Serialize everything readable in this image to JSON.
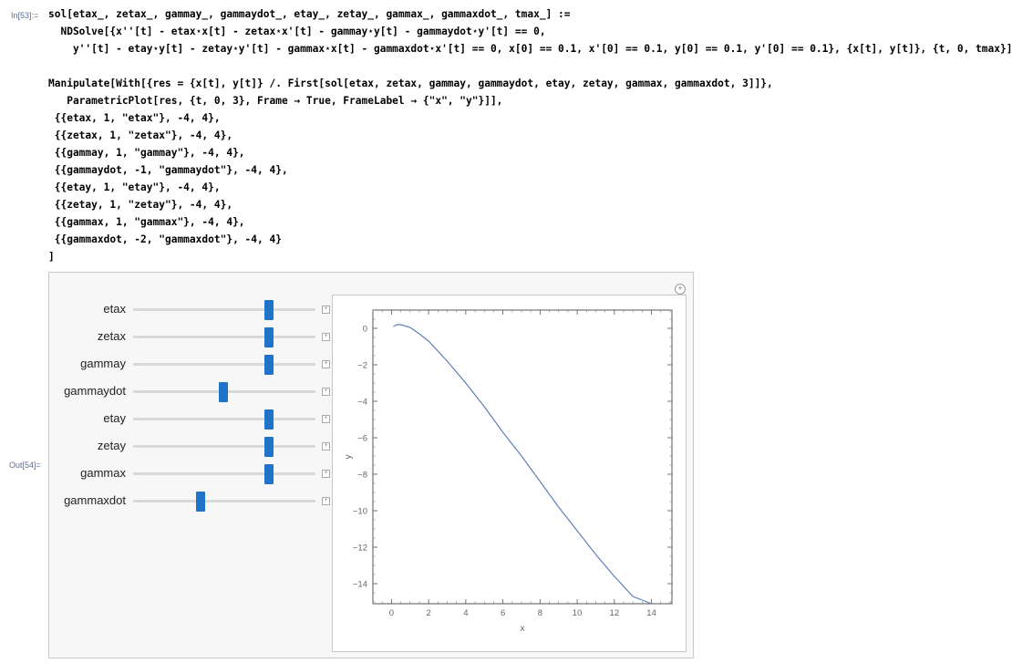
{
  "cells": {
    "in_label": "In[53]:=",
    "out_label": "Out[54]="
  },
  "code_lines": [
    "sol[etax_, zetax_, gammay_, gammaydot_, etay_, zetay_, gammax_, gammaxdot_, tmax_] :=",
    "  NDSolve[{x''[t] - etax⋆x[t] - zetax⋆x'[t] - gammay⋆y[t] - gammaydot⋆y'[t] == 0,",
    "    y''[t] - etay⋆y[t] - zetay⋆y'[t] - gammax⋆x[t] - gammaxdot⋆x'[t] == 0, x[0] == 0.1, x'[0] == 0.1, y[0] == 0.1, y'[0] == 0.1}, {x[t], y[t]}, {t, 0, tmax}]",
    "",
    "Manipulate[With[{res = {x[t], y[t]} /. First[sol[etax, zetax, gammay, gammaydot, etay, zetay, gammax, gammaxdot, 3]]},",
    "   ParametricPlot[res, {t, 0, 3}, Frame → True, FrameLabel → {\"x\", \"y\"}]],",
    " {{etax, 1, \"etax\"}, -4, 4},",
    " {{zetax, 1, \"zetax\"}, -4, 4},",
    " {{gammay, 1, \"gammay\"}, -4, 4},",
    " {{gammaydot, -1, \"gammaydot\"}, -4, 4},",
    " {{etay, 1, \"etay\"}, -4, 4},",
    " {{zetay, 1, \"zetay\"}, -4, 4},",
    " {{gammax, 1, \"gammax\"}, -4, 4},",
    " {{gammaxdot, -2, \"gammaxdot\"}, -4, 4}",
    "]"
  ],
  "controls": [
    {
      "label": "etax",
      "value": 1,
      "min": -4,
      "max": 4
    },
    {
      "label": "zetax",
      "value": 1,
      "min": -4,
      "max": 4
    },
    {
      "label": "gammay",
      "value": 1,
      "min": -4,
      "max": 4
    },
    {
      "label": "gammaydot",
      "value": -1,
      "min": -4,
      "max": 4
    },
    {
      "label": "etay",
      "value": 1,
      "min": -4,
      "max": 4
    },
    {
      "label": "zetay",
      "value": 1,
      "min": -4,
      "max": 4
    },
    {
      "label": "gammax",
      "value": 1,
      "min": -4,
      "max": 4
    },
    {
      "label": "gammaxdot",
      "value": -2,
      "min": -4,
      "max": 4
    }
  ],
  "chart_data": {
    "type": "line",
    "xlabel": "x",
    "ylabel": "y",
    "xlim": [
      -1.0,
      15.1
    ],
    "ylim": [
      -15.1,
      1.0
    ],
    "xticks": [
      0,
      2,
      4,
      6,
      8,
      10,
      12,
      14
    ],
    "yticks": [
      0,
      -2,
      -4,
      -6,
      -8,
      -10,
      -12,
      -14
    ],
    "series": [
      {
        "color": "#5e81b5",
        "x": [
          0.1,
          0.3,
          0.5,
          1.0,
          1.5,
          2.0,
          3.0,
          4.0,
          5.0,
          6.0,
          7.0,
          8.0,
          9.0,
          10.0,
          11.0,
          12.0,
          13.0,
          14.0
        ],
        "y": [
          0.1,
          0.2,
          0.2,
          0.05,
          -0.3,
          -0.7,
          -1.8,
          -3.0,
          -4.3,
          -5.7,
          -7.0,
          -8.4,
          -9.8,
          -11.1,
          -12.4,
          -13.6,
          -14.7,
          -15.1
        ]
      }
    ]
  },
  "colors": {
    "thumb": "#1f73c9",
    "curve": "#5e81b5",
    "label_blue": "#5b6f94"
  }
}
